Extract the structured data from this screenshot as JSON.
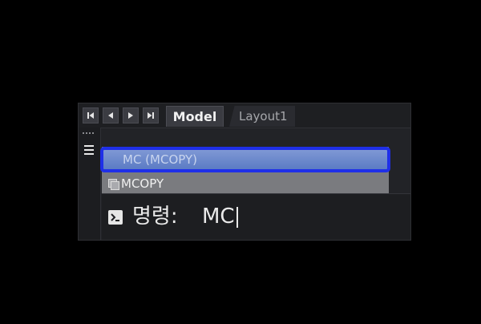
{
  "tabs": {
    "model": "Model",
    "layout1": "Layout1"
  },
  "nav": [
    "first-icon",
    "prev-icon",
    "next-icon",
    "last-icon"
  ],
  "autocomplete": {
    "selected": "MC (MCOPY)",
    "items": [
      {
        "label": "MCOPY",
        "icon": "copy-icon"
      }
    ]
  },
  "command": {
    "prompt": "명령:",
    "input": "MC"
  },
  "colors": {
    "selection_border": "#1f2fe8",
    "selection_fill": "#6f8ccd",
    "panel": "#222327"
  }
}
